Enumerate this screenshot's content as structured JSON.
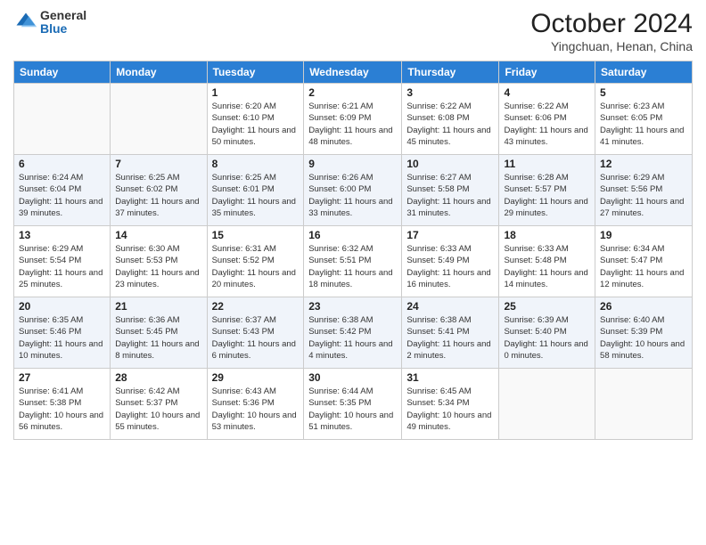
{
  "header": {
    "logo_general": "General",
    "logo_blue": "Blue",
    "month_title": "October 2024",
    "location": "Yingchuan, Henan, China"
  },
  "days_of_week": [
    "Sunday",
    "Monday",
    "Tuesday",
    "Wednesday",
    "Thursday",
    "Friday",
    "Saturday"
  ],
  "weeks": [
    [
      {
        "day": "",
        "sunrise": "",
        "sunset": "",
        "daylight": ""
      },
      {
        "day": "",
        "sunrise": "",
        "sunset": "",
        "daylight": ""
      },
      {
        "day": "1",
        "sunrise": "Sunrise: 6:20 AM",
        "sunset": "Sunset: 6:10 PM",
        "daylight": "Daylight: 11 hours and 50 minutes."
      },
      {
        "day": "2",
        "sunrise": "Sunrise: 6:21 AM",
        "sunset": "Sunset: 6:09 PM",
        "daylight": "Daylight: 11 hours and 48 minutes."
      },
      {
        "day": "3",
        "sunrise": "Sunrise: 6:22 AM",
        "sunset": "Sunset: 6:08 PM",
        "daylight": "Daylight: 11 hours and 45 minutes."
      },
      {
        "day": "4",
        "sunrise": "Sunrise: 6:22 AM",
        "sunset": "Sunset: 6:06 PM",
        "daylight": "Daylight: 11 hours and 43 minutes."
      },
      {
        "day": "5",
        "sunrise": "Sunrise: 6:23 AM",
        "sunset": "Sunset: 6:05 PM",
        "daylight": "Daylight: 11 hours and 41 minutes."
      }
    ],
    [
      {
        "day": "6",
        "sunrise": "Sunrise: 6:24 AM",
        "sunset": "Sunset: 6:04 PM",
        "daylight": "Daylight: 11 hours and 39 minutes."
      },
      {
        "day": "7",
        "sunrise": "Sunrise: 6:25 AM",
        "sunset": "Sunset: 6:02 PM",
        "daylight": "Daylight: 11 hours and 37 minutes."
      },
      {
        "day": "8",
        "sunrise": "Sunrise: 6:25 AM",
        "sunset": "Sunset: 6:01 PM",
        "daylight": "Daylight: 11 hours and 35 minutes."
      },
      {
        "day": "9",
        "sunrise": "Sunrise: 6:26 AM",
        "sunset": "Sunset: 6:00 PM",
        "daylight": "Daylight: 11 hours and 33 minutes."
      },
      {
        "day": "10",
        "sunrise": "Sunrise: 6:27 AM",
        "sunset": "Sunset: 5:58 PM",
        "daylight": "Daylight: 11 hours and 31 minutes."
      },
      {
        "day": "11",
        "sunrise": "Sunrise: 6:28 AM",
        "sunset": "Sunset: 5:57 PM",
        "daylight": "Daylight: 11 hours and 29 minutes."
      },
      {
        "day": "12",
        "sunrise": "Sunrise: 6:29 AM",
        "sunset": "Sunset: 5:56 PM",
        "daylight": "Daylight: 11 hours and 27 minutes."
      }
    ],
    [
      {
        "day": "13",
        "sunrise": "Sunrise: 6:29 AM",
        "sunset": "Sunset: 5:54 PM",
        "daylight": "Daylight: 11 hours and 25 minutes."
      },
      {
        "day": "14",
        "sunrise": "Sunrise: 6:30 AM",
        "sunset": "Sunset: 5:53 PM",
        "daylight": "Daylight: 11 hours and 23 minutes."
      },
      {
        "day": "15",
        "sunrise": "Sunrise: 6:31 AM",
        "sunset": "Sunset: 5:52 PM",
        "daylight": "Daylight: 11 hours and 20 minutes."
      },
      {
        "day": "16",
        "sunrise": "Sunrise: 6:32 AM",
        "sunset": "Sunset: 5:51 PM",
        "daylight": "Daylight: 11 hours and 18 minutes."
      },
      {
        "day": "17",
        "sunrise": "Sunrise: 6:33 AM",
        "sunset": "Sunset: 5:49 PM",
        "daylight": "Daylight: 11 hours and 16 minutes."
      },
      {
        "day": "18",
        "sunrise": "Sunrise: 6:33 AM",
        "sunset": "Sunset: 5:48 PM",
        "daylight": "Daylight: 11 hours and 14 minutes."
      },
      {
        "day": "19",
        "sunrise": "Sunrise: 6:34 AM",
        "sunset": "Sunset: 5:47 PM",
        "daylight": "Daylight: 11 hours and 12 minutes."
      }
    ],
    [
      {
        "day": "20",
        "sunrise": "Sunrise: 6:35 AM",
        "sunset": "Sunset: 5:46 PM",
        "daylight": "Daylight: 11 hours and 10 minutes."
      },
      {
        "day": "21",
        "sunrise": "Sunrise: 6:36 AM",
        "sunset": "Sunset: 5:45 PM",
        "daylight": "Daylight: 11 hours and 8 minutes."
      },
      {
        "day": "22",
        "sunrise": "Sunrise: 6:37 AM",
        "sunset": "Sunset: 5:43 PM",
        "daylight": "Daylight: 11 hours and 6 minutes."
      },
      {
        "day": "23",
        "sunrise": "Sunrise: 6:38 AM",
        "sunset": "Sunset: 5:42 PM",
        "daylight": "Daylight: 11 hours and 4 minutes."
      },
      {
        "day": "24",
        "sunrise": "Sunrise: 6:38 AM",
        "sunset": "Sunset: 5:41 PM",
        "daylight": "Daylight: 11 hours and 2 minutes."
      },
      {
        "day": "25",
        "sunrise": "Sunrise: 6:39 AM",
        "sunset": "Sunset: 5:40 PM",
        "daylight": "Daylight: 11 hours and 0 minutes."
      },
      {
        "day": "26",
        "sunrise": "Sunrise: 6:40 AM",
        "sunset": "Sunset: 5:39 PM",
        "daylight": "Daylight: 10 hours and 58 minutes."
      }
    ],
    [
      {
        "day": "27",
        "sunrise": "Sunrise: 6:41 AM",
        "sunset": "Sunset: 5:38 PM",
        "daylight": "Daylight: 10 hours and 56 minutes."
      },
      {
        "day": "28",
        "sunrise": "Sunrise: 6:42 AM",
        "sunset": "Sunset: 5:37 PM",
        "daylight": "Daylight: 10 hours and 55 minutes."
      },
      {
        "day": "29",
        "sunrise": "Sunrise: 6:43 AM",
        "sunset": "Sunset: 5:36 PM",
        "daylight": "Daylight: 10 hours and 53 minutes."
      },
      {
        "day": "30",
        "sunrise": "Sunrise: 6:44 AM",
        "sunset": "Sunset: 5:35 PM",
        "daylight": "Daylight: 10 hours and 51 minutes."
      },
      {
        "day": "31",
        "sunrise": "Sunrise: 6:45 AM",
        "sunset": "Sunset: 5:34 PM",
        "daylight": "Daylight: 10 hours and 49 minutes."
      },
      {
        "day": "",
        "sunrise": "",
        "sunset": "",
        "daylight": ""
      },
      {
        "day": "",
        "sunrise": "",
        "sunset": "",
        "daylight": ""
      }
    ]
  ]
}
